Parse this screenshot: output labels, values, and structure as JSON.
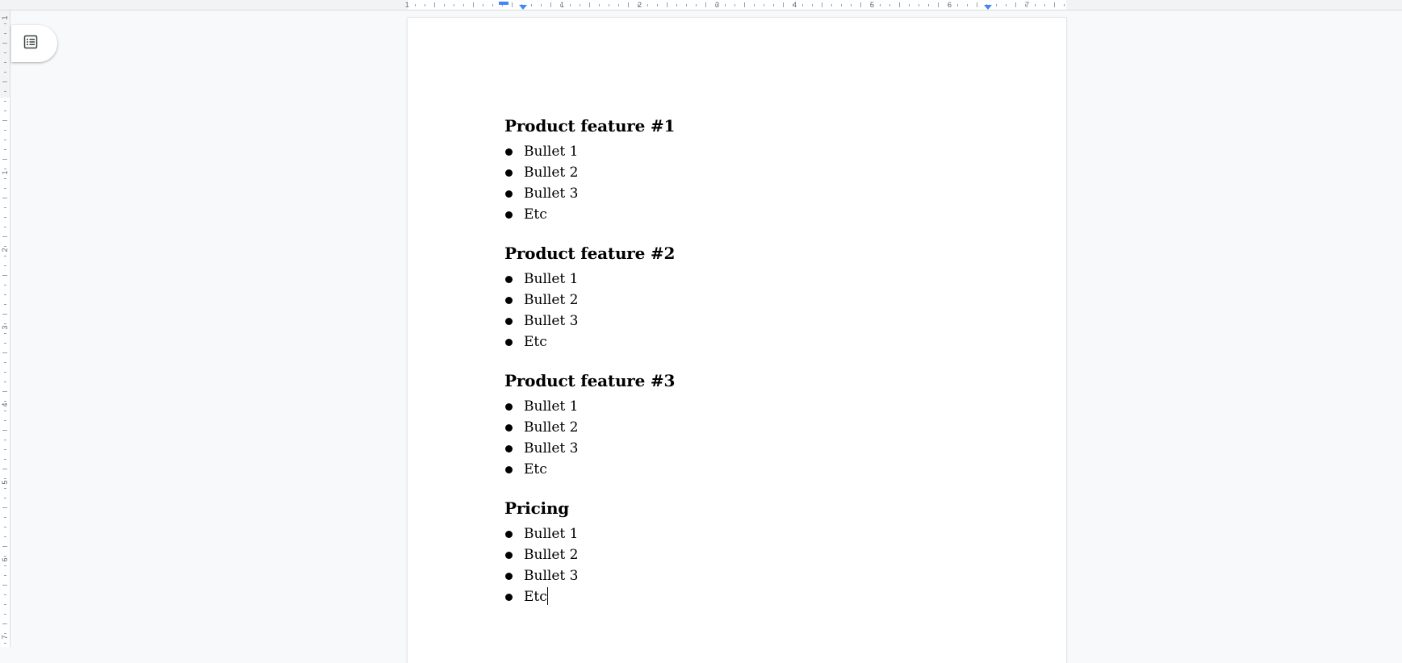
{
  "ruler": {
    "horizontal_numbers": [
      "1",
      "1",
      "2",
      "3",
      "4",
      "5",
      "6",
      "7"
    ],
    "vertical_numbers": [
      "1",
      "1",
      "2",
      "3",
      "4",
      "5",
      "6",
      "7"
    ]
  },
  "outline_button": {
    "icon": "document-outline-icon"
  },
  "document": {
    "sections": [
      {
        "heading": "Product feature #1",
        "bullets": [
          "Bullet 1",
          "Bullet 2",
          "Bullet 3",
          "Etc"
        ]
      },
      {
        "heading": "Product feature #2",
        "bullets": [
          "Bullet 1",
          "Bullet 2",
          "Bullet 3",
          "Etc"
        ]
      },
      {
        "heading": "Product feature #3",
        "bullets": [
          "Bullet 1",
          "Bullet 2",
          "Bullet 3",
          "Etc"
        ]
      },
      {
        "heading": "Pricing",
        "bullets": [
          "Bullet 1",
          "Bullet 2",
          "Bullet 3",
          "Etc"
        ]
      }
    ]
  },
  "colors": {
    "accent": "#4285f4",
    "canvas": "#f8f9fa",
    "page": "#ffffff",
    "text": "#000000"
  }
}
